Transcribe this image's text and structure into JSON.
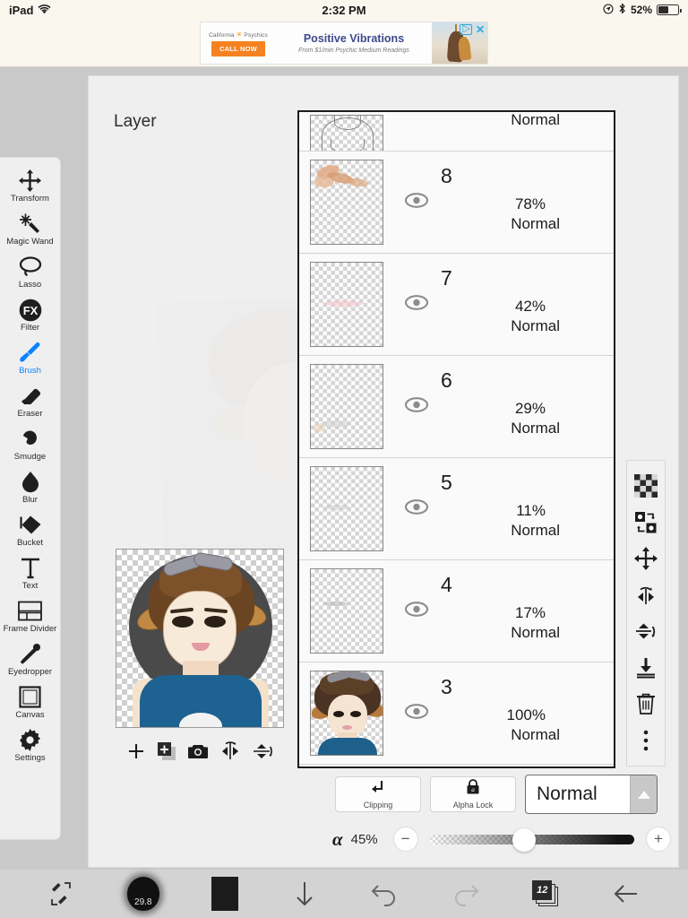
{
  "status_bar": {
    "device": "iPad",
    "wifi_icon": "wifi-icon",
    "time": "2:32 PM",
    "location_icon": "location-icon",
    "bluetooth_icon": "bluetooth-icon",
    "battery_percent": "52%",
    "battery_icon": "battery-icon"
  },
  "ad": {
    "brand": "California",
    "brand2": "Psychics",
    "cta_label": "CALL NOW",
    "title": "Positive Vibrations",
    "subtitle": "From $1/min Psychic Medium Readings",
    "play_icon": "ad-play-icon",
    "close_icon": "ad-close-icon"
  },
  "tools": [
    {
      "label": "Transform",
      "icon": "transform-icon",
      "active": false
    },
    {
      "label": "Magic Wand",
      "icon": "magic-wand-icon",
      "active": false
    },
    {
      "label": "Lasso",
      "icon": "lasso-icon",
      "active": false
    },
    {
      "label": "Filter",
      "icon": "filter-fx-icon",
      "active": false
    },
    {
      "label": "Brush",
      "icon": "brush-icon",
      "active": true
    },
    {
      "label": "Eraser",
      "icon": "eraser-icon",
      "active": false
    },
    {
      "label": "Smudge",
      "icon": "smudge-icon",
      "active": false
    },
    {
      "label": "Blur",
      "icon": "blur-drop-icon",
      "active": false
    },
    {
      "label": "Bucket",
      "icon": "bucket-icon",
      "active": false
    },
    {
      "label": "Text",
      "icon": "text-icon",
      "active": false
    },
    {
      "label": "Frame Divider",
      "icon": "frame-divider-icon",
      "active": false
    },
    {
      "label": "Eyedropper",
      "icon": "eyedropper-icon",
      "active": false
    },
    {
      "label": "Canvas",
      "icon": "canvas-icon",
      "active": false
    },
    {
      "label": "Settings",
      "icon": "gear-icon",
      "active": false
    }
  ],
  "panel": {
    "title": "Layer",
    "layers": [
      {
        "number": "",
        "opacity": "",
        "blend": "Normal",
        "visible": true,
        "partial": true,
        "art": "sketch-body"
      },
      {
        "number": "8",
        "opacity": "78%",
        "blend": "Normal",
        "visible": true,
        "partial": false,
        "art": "skin-strokes"
      },
      {
        "number": "7",
        "opacity": "42%",
        "blend": "Normal",
        "visible": true,
        "partial": false,
        "art": "pink-strokes"
      },
      {
        "number": "6",
        "opacity": "29%",
        "blend": "Normal",
        "visible": true,
        "partial": false,
        "art": "faint-strokes"
      },
      {
        "number": "5",
        "opacity": "11%",
        "blend": "Normal",
        "visible": true,
        "partial": false,
        "art": "faint-strokes-2"
      },
      {
        "number": "4",
        "opacity": "17%",
        "blend": "Normal",
        "visible": true,
        "partial": false,
        "art": "faint-strokes-3"
      },
      {
        "number": "3",
        "opacity": "100%",
        "blend": "Normal",
        "visible": true,
        "partial": false,
        "art": "portrait"
      }
    ]
  },
  "preview_tools": [
    {
      "icon": "add-layer-icon"
    },
    {
      "icon": "duplicate-layer-icon"
    },
    {
      "icon": "camera-icon"
    },
    {
      "icon": "flip-horizontal-icon"
    },
    {
      "icon": "flip-vertical-icon"
    }
  ],
  "right_tools": [
    {
      "icon": "transparency-checker-icon"
    },
    {
      "icon": "swap-layers-icon"
    },
    {
      "icon": "move-layer-icon"
    },
    {
      "icon": "flip-horizontal-icon"
    },
    {
      "icon": "flip-vertical-icon"
    },
    {
      "icon": "merge-down-icon"
    },
    {
      "icon": "trash-icon"
    },
    {
      "icon": "more-options-icon"
    }
  ],
  "options": {
    "clipping_label": "Clipping",
    "clipping_icon": "clipping-arrow-icon",
    "alpha_lock_label": "Alpha Lock",
    "alpha_lock_icon": "alpha-lock-icon",
    "blend_mode": "Normal",
    "blend_arrow_icon": "chevron-up-icon"
  },
  "alpha": {
    "symbol": "α",
    "value": "45%",
    "minus_label": "−",
    "plus_label": "+"
  },
  "bottom_bar": {
    "brush_size": "29.8",
    "layer_count": "12",
    "items": [
      {
        "icon": "tool-swap-icon"
      },
      {
        "icon": "brush-size-icon"
      },
      {
        "icon": "color-swatch-icon"
      },
      {
        "icon": "download-arrow-icon"
      },
      {
        "icon": "undo-icon"
      },
      {
        "icon": "redo-icon"
      },
      {
        "icon": "layers-count-icon"
      },
      {
        "icon": "back-arrow-icon"
      }
    ]
  },
  "colors": {
    "accent": "#0a84ff",
    "shirt": "#1d6290",
    "ad_orange": "#f58220",
    "ad_blue": "#3d4a8c",
    "panel_border": "#1c1c1c"
  }
}
